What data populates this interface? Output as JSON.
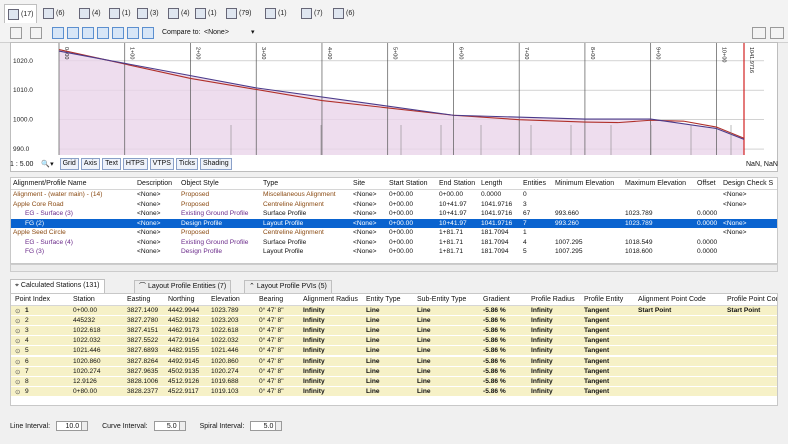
{
  "tabs": [
    {
      "icon": "alignment-icon",
      "count": "(17)"
    },
    {
      "icon": "profile-icon",
      "count": "(6)"
    },
    {
      "icon": "surface-icon",
      "count": "(4)"
    },
    {
      "icon": "corridor-icon",
      "count": "(1)"
    },
    {
      "icon": "parcel-icon",
      "count": "(3)"
    },
    {
      "icon": "pipe-icon",
      "count": "(4)"
    },
    {
      "icon": "point-icon",
      "count": "(1)"
    },
    {
      "icon": "grading-icon",
      "count": "(79)"
    },
    {
      "icon": "section-icon",
      "count": "(1)"
    },
    {
      "icon": "feature-line-icon",
      "count": "(7)"
    },
    {
      "icon": "sheet-icon",
      "count": "(6)"
    }
  ],
  "toolbar": {
    "compare_label": "Compare to:",
    "compare_value": "<None>"
  },
  "chart_data": {
    "type": "line",
    "y_ticks": [
      "1020.0",
      "1010.0",
      "1000.0",
      "990.0"
    ],
    "ylim": [
      988,
      1024
    ],
    "x_range": [
      0,
      1041.9716
    ],
    "station_labels": [
      "0+00",
      "1+00",
      "2+00",
      "3+00",
      "4+00",
      "5+00",
      "6+00",
      "7+00",
      "8+00",
      "9+00",
      "10+00",
      "1041.9716"
    ],
    "series": [
      {
        "name": "FG (2)",
        "x": [
          0,
          300,
          600,
          800,
          900,
          1000,
          1041.97
        ],
        "y": [
          1023.3,
          1010.8,
          1001.5,
          1000.2,
          1000.2,
          997.0,
          993.3
        ]
      },
      {
        "name": "EG - Surface (3)",
        "x": [
          0,
          200,
          400,
          600,
          700,
          800,
          850,
          900,
          950,
          1000,
          1041.97
        ],
        "y": [
          1023.8,
          1014.0,
          1006.5,
          1001.5,
          1000.0,
          999.2,
          999.0,
          999.8,
          999.5,
          997.5,
          993.7
        ]
      }
    ],
    "scale_label": "1 : 5.00",
    "coord_readout": "NaN, NaN",
    "buttons": [
      "Grid",
      "Axis",
      "Text",
      "HTPS",
      "VTPS",
      "Ticks",
      "Shading"
    ]
  },
  "profiles_table": {
    "headers": [
      "Alignment/Profile Name",
      "Description",
      "Object Style",
      "Type",
      "Site",
      "Start Station",
      "End Station",
      "Length",
      "Entities",
      "Minimum Elevation",
      "Maximum Elevation",
      "Offset",
      "Design Check S"
    ],
    "rows": [
      {
        "name": "Alignment - (water main) - (14)",
        "desc": "<None>",
        "style": "Proposed",
        "type": "Miscellaneous Alignment",
        "site": "<None>",
        "start": "0+00.00",
        "end": "0+00.00",
        "length": "0.0000",
        "entities": "0",
        "min": "",
        "max": "",
        "offset": "",
        "dcs": "<None>",
        "kind": "align"
      },
      {
        "name": "Apple Core Road",
        "desc": "<None>",
        "style": "Proposed",
        "type": "Centreline Alignment",
        "site": "<None>",
        "start": "0+00.00",
        "end": "10+41.97",
        "length": "1041.9716",
        "entities": "3",
        "min": "",
        "max": "",
        "offset": "",
        "dcs": "<None>",
        "kind": "align"
      },
      {
        "name": "EG - Surface (3)",
        "desc": "<None>",
        "style": "Existing Ground Profile",
        "type": "Surface Profile",
        "site": "<None>",
        "start": "0+00.00",
        "end": "10+41.97",
        "length": "1041.9716",
        "entities": "67",
        "min": "993.660",
        "max": "1023.789",
        "offset": "0.0000",
        "dcs": "",
        "kind": "prof"
      },
      {
        "name": "FG (2)",
        "desc": "<None>",
        "style": "Design Profile",
        "type": "Layout Profile",
        "site": "<None>",
        "start": "0+00.00",
        "end": "10+41.97",
        "length": "1041.9716",
        "entities": "7",
        "min": "993.260",
        "max": "1023.789",
        "offset": "0.0000",
        "dcs": "<None>",
        "kind": "sel"
      },
      {
        "name": "Apple Seed Circle",
        "desc": "<None>",
        "style": "Proposed",
        "type": "Centreline Alignment",
        "site": "<None>",
        "start": "0+00.00",
        "end": "1+81.71",
        "length": "181.7094",
        "entities": "1",
        "min": "",
        "max": "",
        "offset": "",
        "dcs": "<None>",
        "kind": "align"
      },
      {
        "name": "EG - Surface (4)",
        "desc": "<None>",
        "style": "Existing Ground Profile",
        "type": "Surface Profile",
        "site": "<None>",
        "start": "0+00.00",
        "end": "1+81.71",
        "length": "181.7094",
        "entities": "4",
        "min": "1007.295",
        "max": "1018.549",
        "offset": "0.0000",
        "dcs": "",
        "kind": "prof"
      },
      {
        "name": "FG (3)",
        "desc": "<None>",
        "style": "Design Profile",
        "type": "Layout Profile",
        "site": "<None>",
        "start": "0+00.00",
        "end": "1+81.71",
        "length": "181.7094",
        "entities": "5",
        "min": "1007.295",
        "max": "1018.600",
        "offset": "0.0000",
        "dcs": "",
        "kind": "prof"
      }
    ]
  },
  "bottom_tabs": [
    "Calculated Stations (131)",
    "Layout Profile Entities (7)",
    "Layout Profile PVIs (5)"
  ],
  "stations_table": {
    "headers": [
      "Point Index",
      "Station",
      "Easting",
      "Northing",
      "Elevation",
      "Bearing",
      "Alignment Radius",
      "Entity Type",
      "Sub-Entity Type",
      "Gradient",
      "Profile Radius",
      "Profile Entity",
      "Alignment Point Code",
      "Profile Point Code"
    ],
    "rows": [
      [
        "1",
        "0+00.00",
        "3827.1409",
        "4442.9944",
        "1023.789",
        "0° 47' 8\"",
        "Infinity",
        "Line",
        "Line",
        "-5.86 %",
        "Infinity",
        "Tangent",
        "Start Point",
        "Start Point"
      ],
      [
        "2",
        "445232",
        "3827.2780",
        "4452.9182",
        "1023.203",
        "0° 47' 8\"",
        "Infinity",
        "Line",
        "Line",
        "-5.86 %",
        "Infinity",
        "Tangent",
        "",
        ""
      ],
      [
        "3",
        "1022.618",
        "3827.4151",
        "4462.9173",
        "1022.618",
        "0° 47' 8\"",
        "Infinity",
        "Line",
        "Line",
        "-5.86 %",
        "Infinity",
        "Tangent",
        "",
        ""
      ],
      [
        "4",
        "1022.032",
        "3827.5522",
        "4472.9164",
        "1022.032",
        "0° 47' 8\"",
        "Infinity",
        "Line",
        "Line",
        "-5.86 %",
        "Infinity",
        "Tangent",
        "",
        ""
      ],
      [
        "5",
        "1021.446",
        "3827.6893",
        "4482.9155",
        "1021.446",
        "0° 47' 8\"",
        "Infinity",
        "Line",
        "Line",
        "-5.86 %",
        "Infinity",
        "Tangent",
        "",
        ""
      ],
      [
        "6",
        "1020.860",
        "3827.8264",
        "4492.9145",
        "1020.860",
        "0° 47' 8\"",
        "Infinity",
        "Line",
        "Line",
        "-5.86 %",
        "Infinity",
        "Tangent",
        "",
        ""
      ],
      [
        "7",
        "1020.274",
        "3827.9635",
        "4502.9135",
        "1020.274",
        "0° 47' 8\"",
        "Infinity",
        "Line",
        "Line",
        "-5.86 %",
        "Infinity",
        "Tangent",
        "",
        ""
      ],
      [
        "8",
        "12.9126",
        "3828.1006",
        "4512.9126",
        "1019.688",
        "0° 47' 8\"",
        "Infinity",
        "Line",
        "Line",
        "-5.86 %",
        "Infinity",
        "Tangent",
        "",
        ""
      ],
      [
        "9",
        "0+80.00",
        "3828.2377",
        "4522.9117",
        "1019.103",
        "0° 47' 8\"",
        "Infinity",
        "Line",
        "Line",
        "-5.86 %",
        "Infinity",
        "Tangent",
        "",
        ""
      ]
    ]
  },
  "footer": {
    "line_label": "Line Interval:",
    "line_value": "10.0",
    "curve_label": "Curve Interval:",
    "curve_value": "5.0",
    "spiral_label": "Spiral Interval:",
    "spiral_value": "5.0"
  },
  "colors": {
    "selection": "#0a63cf",
    "eg_line": "#b0302a",
    "fg_line": "#4a3a8a",
    "fill": "#ead5ea",
    "station_line": "#d22020"
  }
}
